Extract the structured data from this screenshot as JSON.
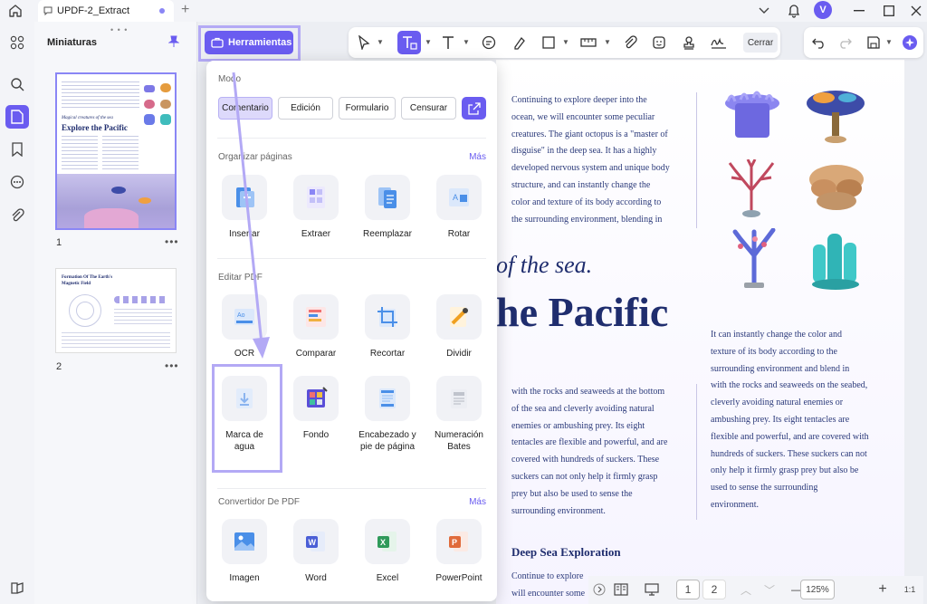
{
  "tab": {
    "title": "UPDF-2_Extract"
  },
  "user": {
    "avatar_letter": "V"
  },
  "thumbnails": {
    "title": "Miniaturas",
    "pages": [
      "1",
      "2"
    ],
    "page1_heading_small": "Magical creatures of the sea",
    "page1_heading": "Explore the Pacific",
    "page2_heading": "Formation Of The Earth's Magnetic Field"
  },
  "toolbar": {
    "tools_label": "Herramientas",
    "close_label": "Cerrar"
  },
  "menu": {
    "mode_label": "Modo",
    "modes": [
      "Comentario",
      "Edición",
      "Formulario",
      "Censurar"
    ],
    "organize_label": "Organizar páginas",
    "organize_more": "Más",
    "organize_tools": [
      "Insertar",
      "Extraer",
      "Reemplazar",
      "Rotar"
    ],
    "edit_label": "Editar PDF",
    "edit_tools": [
      "OCR",
      "Comparar",
      "Recortar",
      "Dividir",
      "Marca de agua",
      "Fondo",
      "Encabezado y pie de página",
      "Numeración Bates"
    ],
    "convert_label": "Convertidor De PDF",
    "convert_more": "Más",
    "convert_tools": [
      "Imagen",
      "Word",
      "Excel",
      "PowerPoint"
    ]
  },
  "pdf": {
    "intro_lines": [
      "Continuing to explore deeper into the",
      "ocean, we will encounter some peculiar",
      "creatures. The giant octopus is a \"master of",
      "disguise\" in the deep sea. It has a highly",
      "developed nervous system and unique body",
      "structure, and can instantly change the",
      "color and texture of its body according to",
      "the surrounding environment, blending in"
    ],
    "italic_title": "of the sea.",
    "big_title": "he Pacific",
    "mid_lines": [
      "with the rocks and seaweeds at the bottom",
      "of the sea and cleverly avoiding natural",
      "enemies or ambushing prey. Its eight",
      "tentacles are flexible and powerful, and are",
      "covered with hundreds of suckers. These",
      "suckers can not only help it firmly grasp",
      "prey but also be used to sense the",
      "surrounding environment."
    ],
    "right_lines": [
      "It can instantly change the color and",
      "texture of its body according to the",
      "surrounding environment and blend in",
      "with the rocks and seaweeds on the seabed,",
      "cleverly avoiding natural enemies or",
      "ambushing prey. Its eight tentacles are",
      "flexible and powerful, and are covered with",
      "hundreds of suckers. These suckers can not",
      "only help it firmly grasp prey but also be",
      "used to sense the surrounding",
      "environment."
    ],
    "section_heading": "Deep Sea Exploration",
    "bottom_lines": [
      "Continue to explore",
      "will encounter some"
    ]
  },
  "bottombar": {
    "page_current": "1",
    "page_next": "2",
    "zoom": "125%"
  },
  "colors": {
    "accent": "#6a5cf0",
    "highlight": "#b3a9f5",
    "title_navy": "#1f2d6e"
  }
}
